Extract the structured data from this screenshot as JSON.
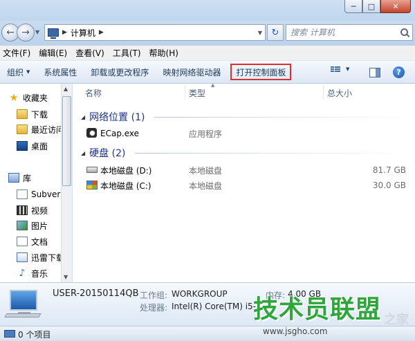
{
  "window": {
    "minimize_glyph": "─",
    "maximize_glyph": "□",
    "close_glyph": "✕"
  },
  "address": {
    "breadcrumb": "计算机",
    "search_placeholder": "搜索 计算机"
  },
  "menu": [
    "文件(F)",
    "编辑(E)",
    "查看(V)",
    "工具(T)",
    "帮助(H)"
  ],
  "toolbar": {
    "organize": "组织",
    "system_properties": "系统属性",
    "uninstall": "卸载或更改程序",
    "map_drive": "映射网络驱动器",
    "open_control_panel": "打开控制面板",
    "help": "?"
  },
  "sidebar": {
    "favorites": "收藏夹",
    "downloads": "下载",
    "recent": "最近访问",
    "desktop": "桌面",
    "libraries": "库",
    "subversion": "Subvers",
    "videos": "视频",
    "pictures": "图片",
    "documents": "文档",
    "xunlei": "迅雷下载",
    "music": "音乐"
  },
  "columns": {
    "name": "名称",
    "type": "类型",
    "total_size": "总大小"
  },
  "groups": [
    {
      "title": "网络位置 (1)",
      "items": [
        {
          "name": "ECap.exe",
          "type": "应用程序",
          "size": ""
        }
      ]
    },
    {
      "title": "硬盘 (2)",
      "items": [
        {
          "name": "本地磁盘 (D:)",
          "type": "本地磁盘",
          "size": "81.7 GB"
        },
        {
          "name": "本地磁盘 (C:)",
          "type": "本地磁盘",
          "size": "30.0 GB"
        }
      ]
    }
  ],
  "details": {
    "computer_name": "USER-20150114QB",
    "workgroup_label": "工作组:",
    "workgroup_value": "WORKGROUP",
    "memory_label": "内存:",
    "memory_value": "4.00 GB",
    "processor_label": "处理器:",
    "processor_value": "Intel(R) Core(TM) i5-3"
  },
  "status": {
    "text": "0 个项目"
  },
  "watermark": {
    "main": "技术员联盟",
    "sub": "www.jsgho.com",
    "side": "之家"
  },
  "colors": {
    "highlight_border": "#e0302c",
    "group_text": "#1e3287",
    "watermark": "#2fa53c"
  }
}
